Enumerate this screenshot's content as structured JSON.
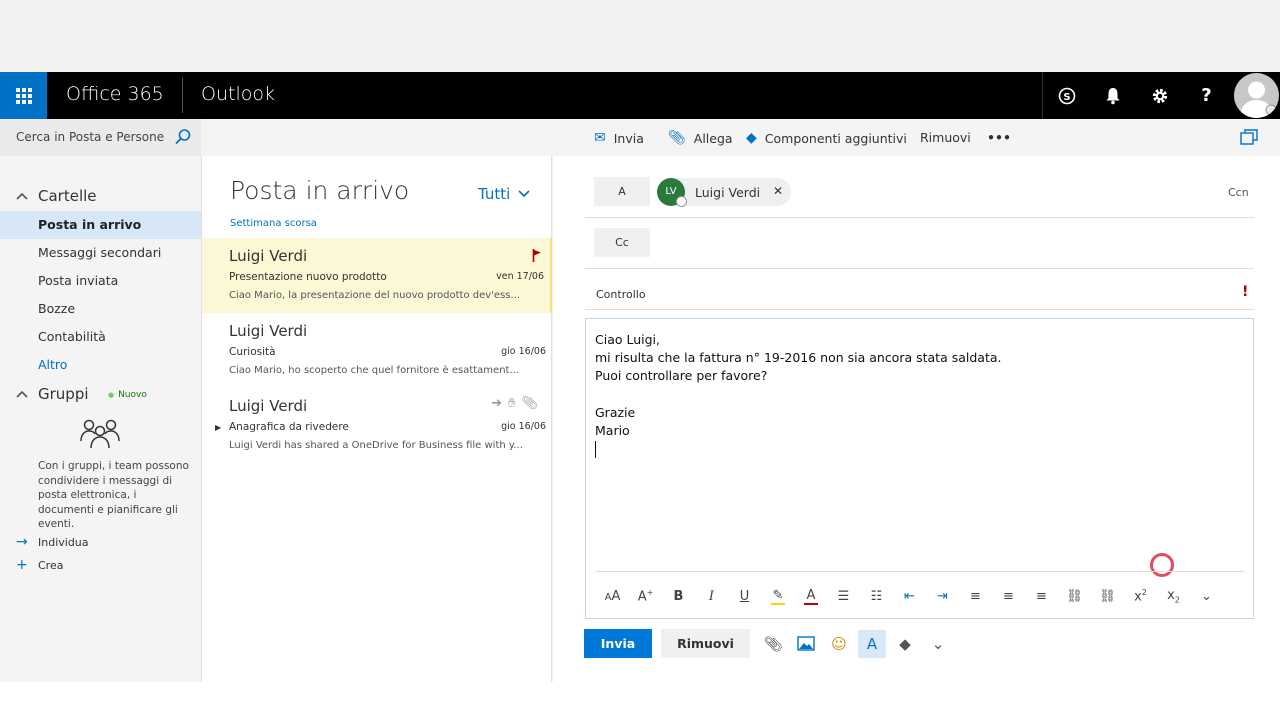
{
  "header": {
    "brand": "Office 365",
    "app": "Outlook",
    "skype_icon": "skype-icon",
    "bell_icon": "bell-icon",
    "gear_icon": "gear-icon",
    "help_label": "?"
  },
  "sidebar": {
    "search_placeholder": "Cerca in Posta e Persone",
    "folders_title": "Cartelle",
    "folders": [
      {
        "label": "Posta in arrivo"
      },
      {
        "label": "Messaggi secondari"
      },
      {
        "label": "Posta inviata"
      },
      {
        "label": "Bozze"
      },
      {
        "label": "Contabilità"
      },
      {
        "label": "Altro"
      }
    ],
    "groups_title": "Gruppi",
    "groups_new": "Nuovo",
    "groups_desc": "Con i gruppi, i team possono condividere i messaggi di posta elettronica, i documenti e pianificare gli eventi.",
    "discover": "Individua",
    "create": "Crea"
  },
  "commands": {
    "send": "Invia",
    "attach": "Allega",
    "addins": "Componenti aggiuntivi",
    "discard": "Rimuovi",
    "more": "•••"
  },
  "message_list": {
    "title": "Posta in arrivo",
    "filter": "Tutti",
    "group_header": "Settimana scorsa",
    "messages": [
      {
        "sender": "Luigi Verdi",
        "subject": "Presentazione nuovo prodotto",
        "date": "ven 17/06",
        "preview": "Ciao Mario, la presentazione del nuovo prodotto dev'ess..."
      },
      {
        "sender": "Luigi Verdi",
        "subject": "Curiosità",
        "date": "gio 16/06",
        "preview": "Ciao Mario, ho scoperto che quel fornitore è esattament..."
      },
      {
        "sender": "Luigi Verdi",
        "subject": "Anagrafica da rivedere",
        "date": "gio 16/06",
        "preview": "Luigi Verdi has shared a OneDrive for Business file with y..."
      }
    ]
  },
  "compose": {
    "to_label": "A",
    "recipient_initials": "LV",
    "recipient_name": "Luigi Verdi",
    "bcc_label": "Ccn",
    "cc_label": "Cc",
    "subject": "Controllo",
    "importance": "!",
    "body": [
      "Ciao Luigi,",
      "mi risulta che la fattura n° 19-2016 non sia ancora stata saldata.",
      "Puoi controllare per favore?",
      "",
      "Grazie",
      "Mario"
    ],
    "send_button": "Invia",
    "discard_button": "Rimuovi"
  },
  "colors": {
    "accent": "#0072c6",
    "header_bg": "#000000",
    "selected_message_bg": "#fcf7d4",
    "flag": "#a80000"
  }
}
